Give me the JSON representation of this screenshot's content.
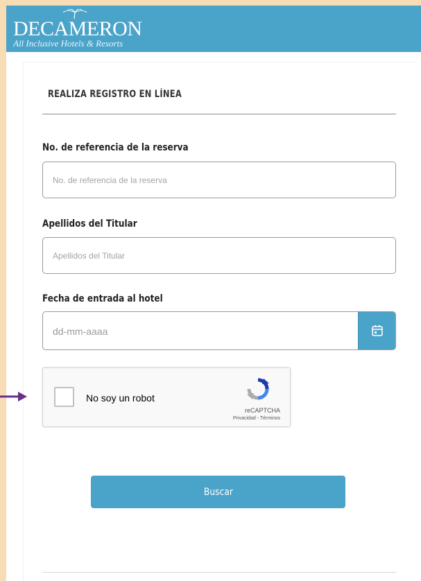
{
  "header": {
    "logo_main": "DECAMERON",
    "logo_sub": "All Inclusive Hotels & Resorts"
  },
  "form": {
    "title": "REALIZA REGISTRO EN LÍNEA",
    "reference": {
      "label": "No. de referencia de la reserva",
      "placeholder": "No. de referencia de la reserva"
    },
    "surname": {
      "label": "Apellidos del Titular",
      "placeholder": "Apellidos del Titular"
    },
    "checkin": {
      "label": "Fecha de entrada al hotel",
      "value": "dd-mm-aaaa",
      "icon": "calendar-icon"
    },
    "captcha": {
      "label": "No soy un robot",
      "brand": "reCAPTCHA",
      "links": "Privacidad - Términos"
    },
    "submit_label": "Buscar"
  },
  "colors": {
    "brand": "#4aa3c9",
    "background": "#f7dcb6",
    "pointer_arrow": "#6a2f86"
  }
}
